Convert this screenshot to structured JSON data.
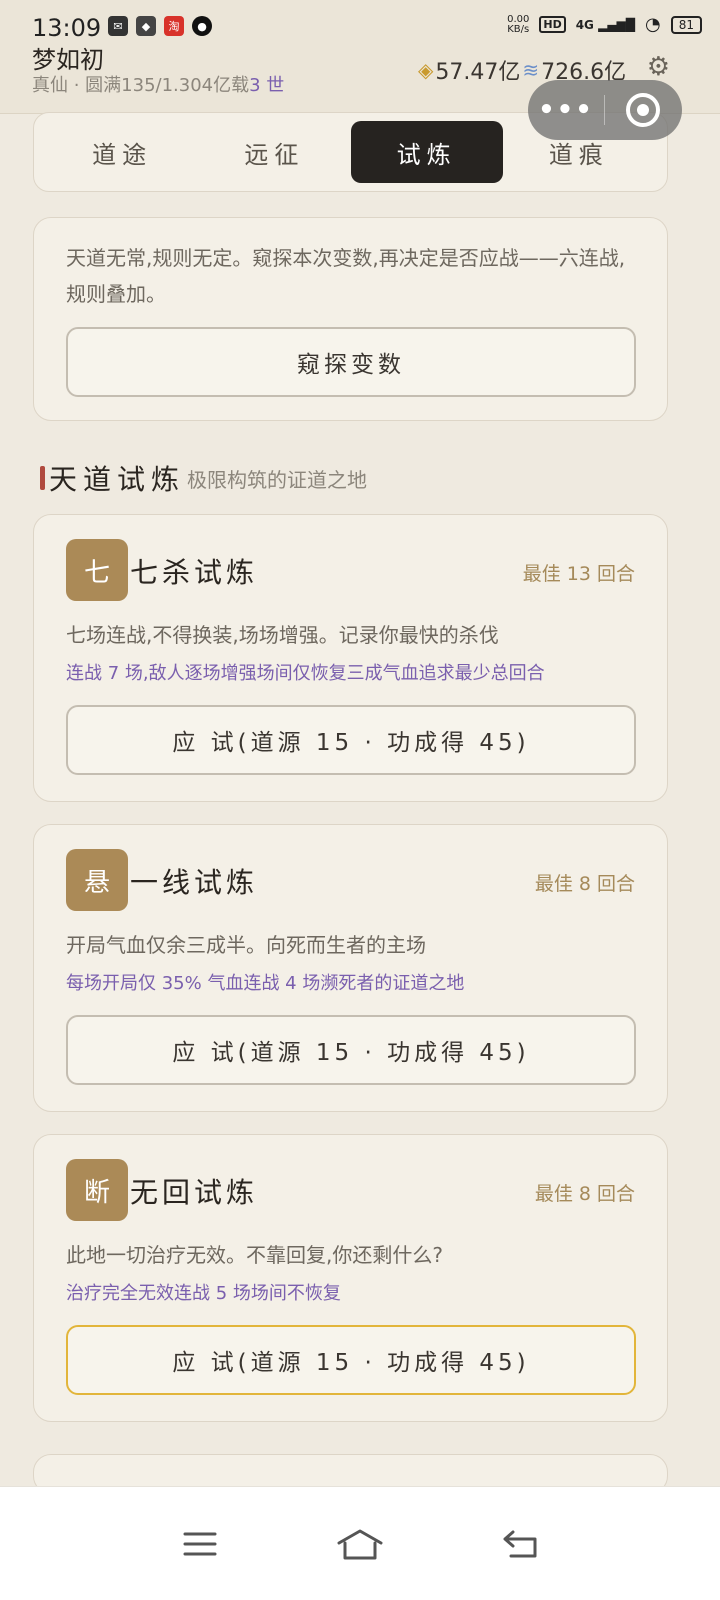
{
  "status_bar": {
    "time": "13:09",
    "net_speed": "0.00",
    "net_unit": "KB/s",
    "hd": "HD",
    "network": "4G",
    "battery": "81"
  },
  "player": {
    "name": "梦如初",
    "realm": "真仙 · 圆满135/1.304亿载",
    "generation": "3 世",
    "gems": "57.47亿",
    "spirit": "726.6亿"
  },
  "tabs": [
    {
      "label": "道途"
    },
    {
      "label": "远征"
    },
    {
      "label": "试炼",
      "active": true
    },
    {
      "label": "道痕"
    }
  ],
  "intro": {
    "text": "天道无常,规则无定。窥探本次变数,再决定是否应战——六连战,规则叠加。",
    "button": "窥探变数"
  },
  "section": {
    "title": "天道试炼",
    "subtitle": "极限构筑的证道之地"
  },
  "trials": [
    {
      "badge": "七",
      "name": "七杀试炼",
      "best": "最佳 13 回合",
      "desc": "七场连战,不得换装,场场增强。记录你最快的杀伐",
      "rules": "连战 7 场,敌人逐场增强场间仅恢复三成气血追求最少总回合",
      "button": "应 试(道源 15 · 功成得 45)"
    },
    {
      "badge": "悬",
      "name": "一线试炼",
      "best": "最佳 8 回合",
      "desc": "开局气血仅余三成半。向死而生者的主场",
      "rules": "每场开局仅 35% 气血连战 4 场濒死者的证道之地",
      "button": "应 试(道源 15 · 功成得 45)"
    },
    {
      "badge": "断",
      "name": "无回试炼",
      "best": "最佳 8 回合",
      "desc": "此地一切治疗无效。不靠回复,你还剩什么?",
      "rules": "治疗完全无效连战 5 场场间不恢复",
      "button": "应 试(道源 15 · 功成得 45)"
    }
  ],
  "colors": {
    "background": "#efeae0",
    "card": "#f4f0e7",
    "active_tab": "#262320",
    "badge": "#ab8a57",
    "rules_text": "#7a5fae",
    "best_text": "#a58a5a",
    "focus_border": "#e2b53a"
  }
}
